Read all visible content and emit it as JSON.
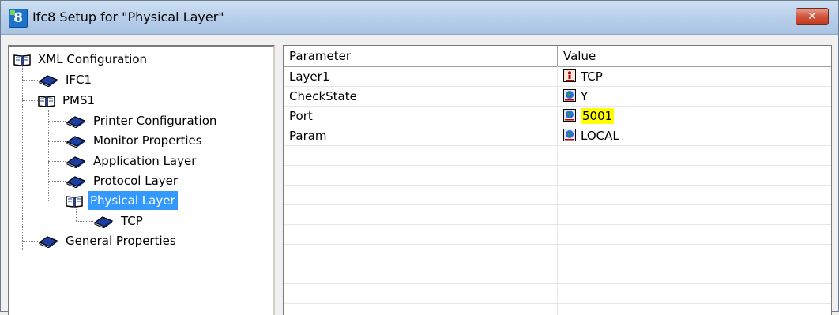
{
  "window": {
    "icon_text": "8",
    "title": "Ifc8 Setup for \"Physical Layer\"",
    "close_glyph": "✕"
  },
  "tree": {
    "root": "XML Configuration",
    "items": [
      {
        "label": "IFC1",
        "icon": "book-closed-icon"
      },
      {
        "label": "PMS1",
        "icon": "book-open-icon"
      },
      {
        "label": "Printer Configuration",
        "icon": "book-closed-icon"
      },
      {
        "label": "Monitor Properties",
        "icon": "book-closed-icon"
      },
      {
        "label": "Application Layer",
        "icon": "book-closed-icon"
      },
      {
        "label": "Protocol Layer",
        "icon": "book-closed-icon"
      },
      {
        "label": "Physical Layer",
        "icon": "book-open-icon",
        "selected": true
      },
      {
        "label": "TCP",
        "icon": "book-closed-icon"
      },
      {
        "label": "General Properties",
        "icon": "book-closed-icon"
      }
    ]
  },
  "list": {
    "columns": [
      "Parameter",
      "Value"
    ],
    "rows": [
      {
        "parameter": "Layer1",
        "value": "TCP",
        "icon": "red-figure-icon"
      },
      {
        "parameter": "CheckState",
        "value": "Y",
        "icon": "globe-icon"
      },
      {
        "parameter": "Port",
        "value": "5001",
        "icon": "globe-icon",
        "highlighted": true
      },
      {
        "parameter": "Param",
        "value": "LOCAL",
        "icon": "globe-icon"
      }
    ]
  },
  "colors": {
    "selection": "#3399ff",
    "highlight": "#ffff00",
    "book_blue": "#1f3fa0"
  }
}
